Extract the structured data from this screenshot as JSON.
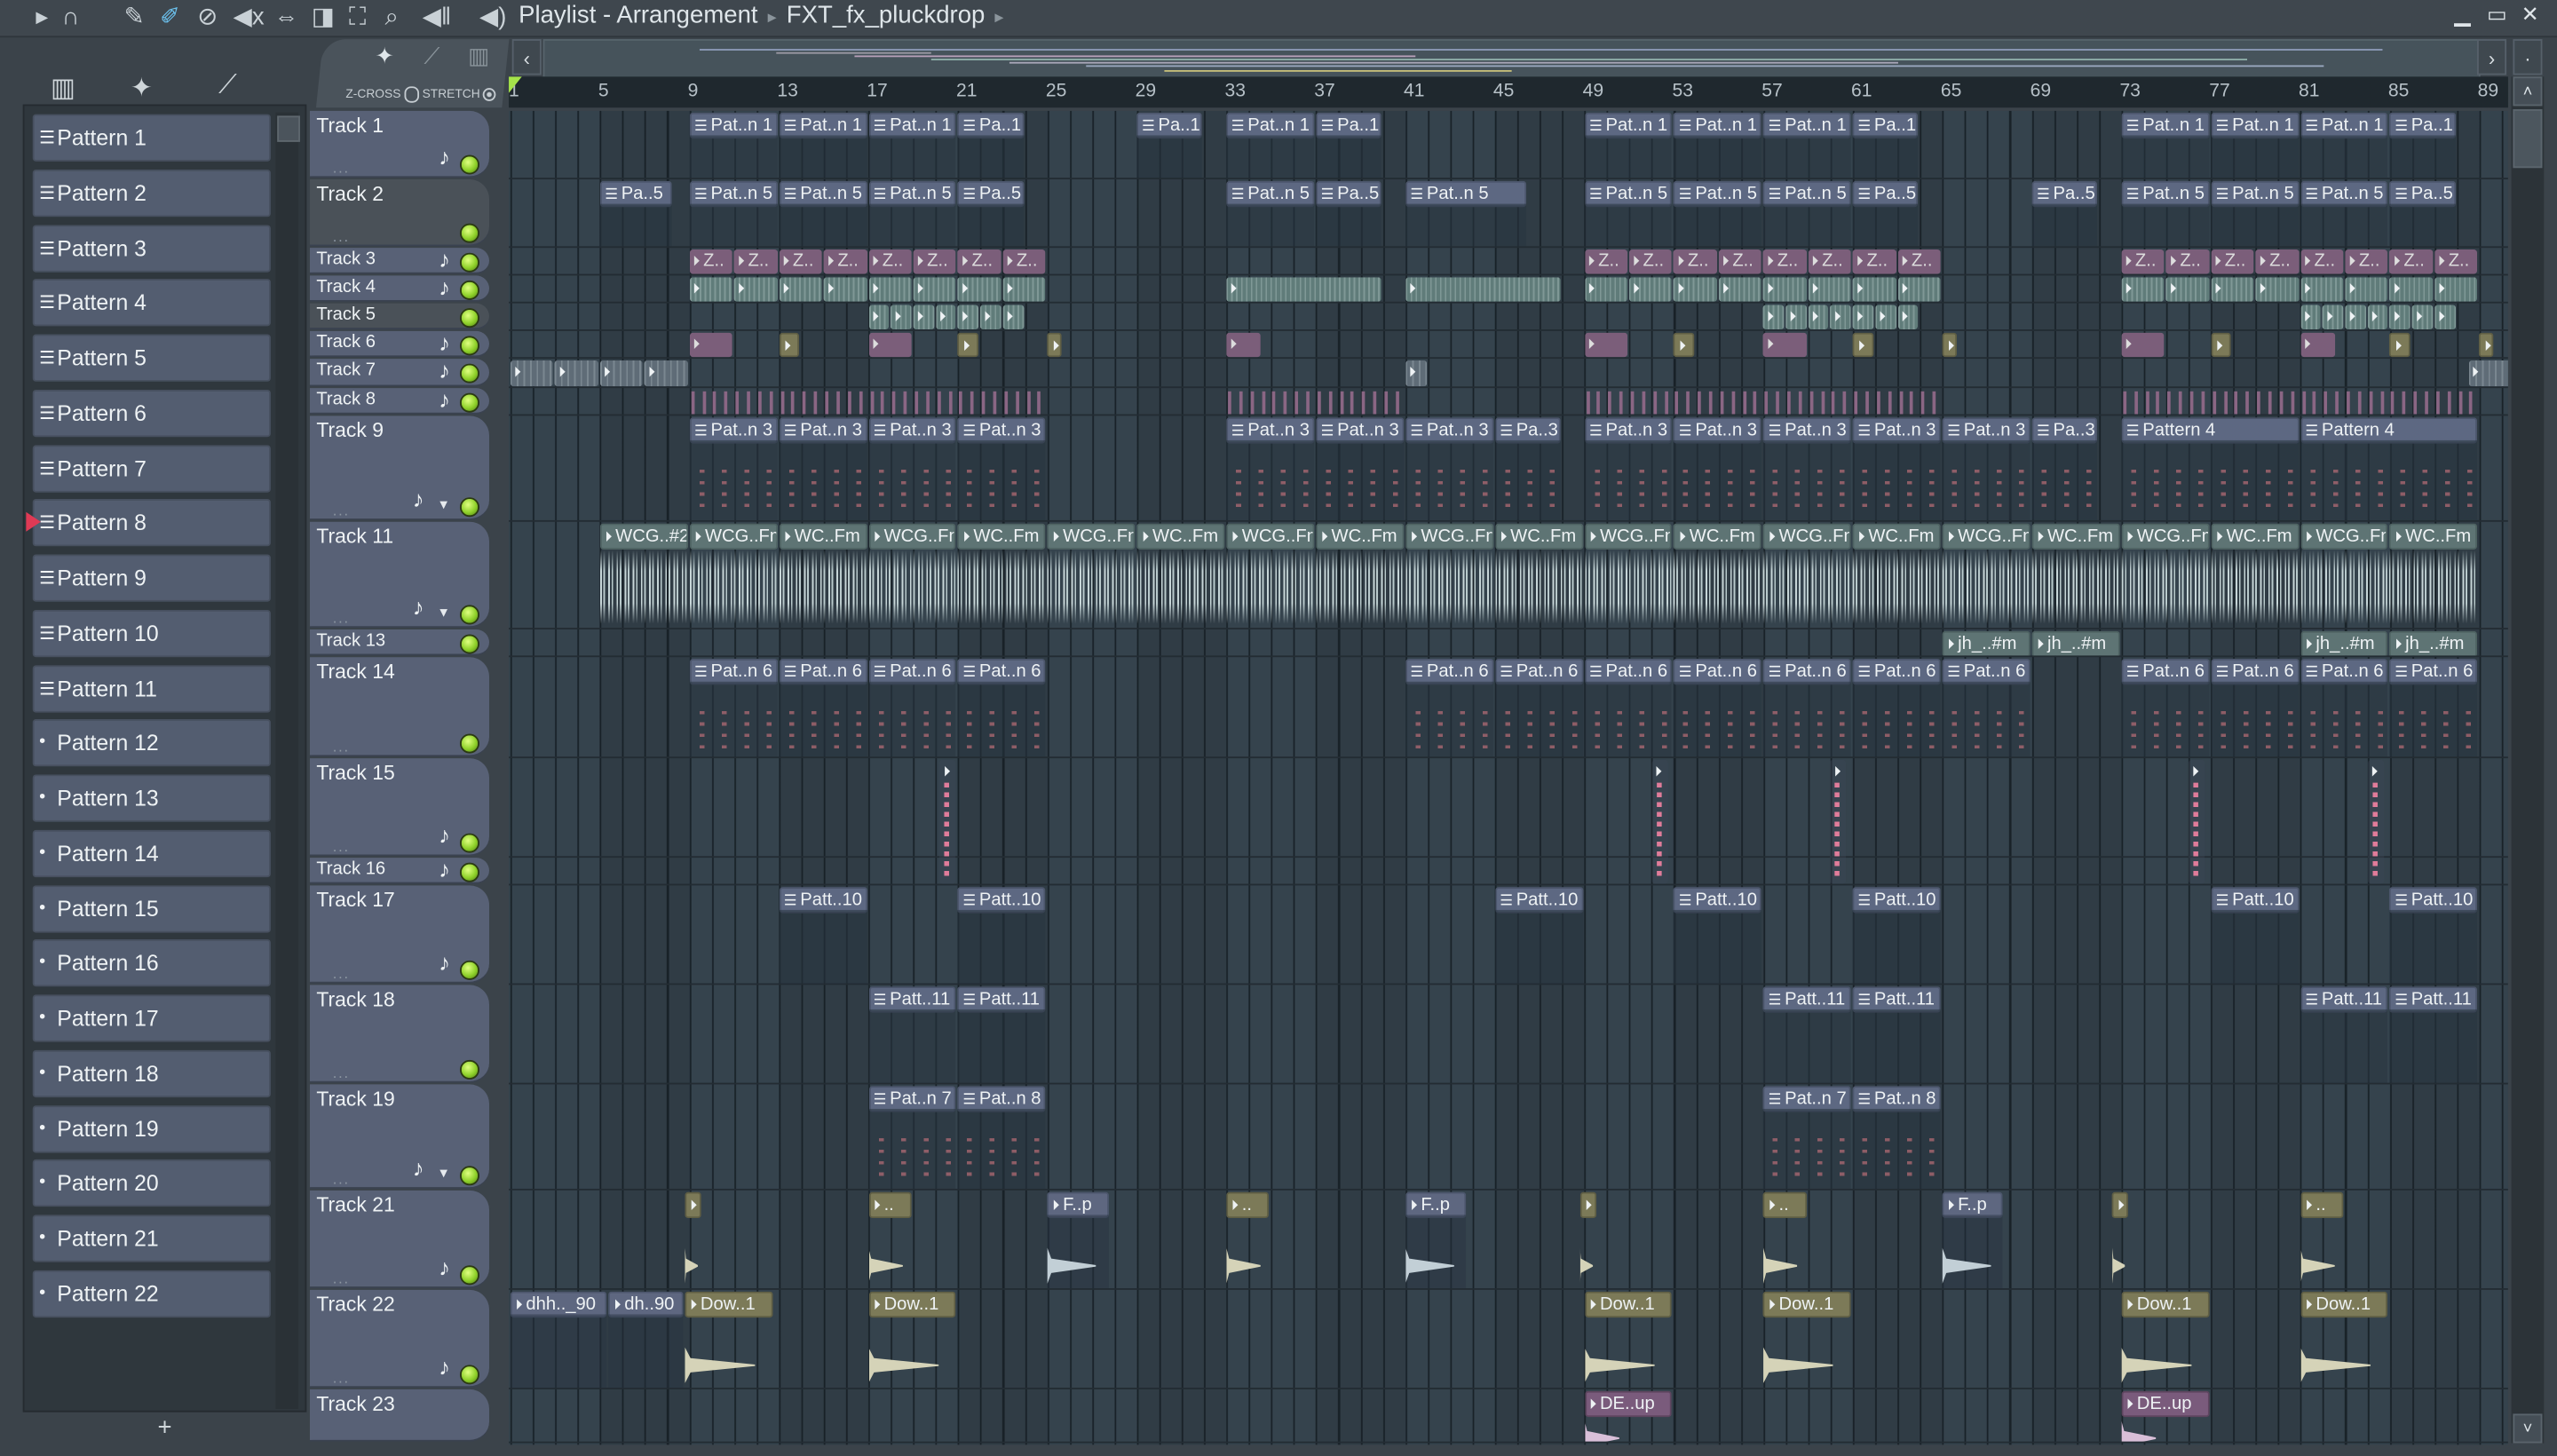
{
  "titlebar": {
    "title": "Playlist - Arrangement",
    "breadcrumb_sep": "▸",
    "current": "FXT_fx_pluckdrop",
    "toolbar_icons": [
      "play-arrow-icon",
      "magnet-snap-icon",
      "pencil-draw-icon",
      "paint-brush-icon",
      "delete-icon",
      "mute-icon",
      "slip-icon",
      "slice-icon",
      "select-icon",
      "zoom-icon",
      "playback-icon",
      "speaker-icon"
    ],
    "window_controls": {
      "minimize": "▁",
      "maximize": "▭",
      "close": "✕"
    }
  },
  "left_panel": {
    "view_icons": [
      "piano-roll-view-icon",
      "audio-view-icon",
      "automation-view-icon"
    ],
    "patterns": [
      {
        "label": "Pattern 1",
        "kind": "pattern"
      },
      {
        "label": "Pattern 2",
        "kind": "pattern"
      },
      {
        "label": "Pattern 3",
        "kind": "pattern"
      },
      {
        "label": "Pattern 4",
        "kind": "pattern"
      },
      {
        "label": "Pattern 5",
        "kind": "pattern"
      },
      {
        "label": "Pattern 6",
        "kind": "pattern"
      },
      {
        "label": "Pattern 7",
        "kind": "pattern"
      },
      {
        "label": "Pattern 8",
        "kind": "pattern",
        "selected": true
      },
      {
        "label": "Pattern 9",
        "kind": "pattern"
      },
      {
        "label": "Pattern 10",
        "kind": "pattern"
      },
      {
        "label": "Pattern 11",
        "kind": "pattern"
      },
      {
        "label": "Pattern 12",
        "kind": "empty"
      },
      {
        "label": "Pattern 13",
        "kind": "empty"
      },
      {
        "label": "Pattern 14",
        "kind": "empty"
      },
      {
        "label": "Pattern 15",
        "kind": "empty"
      },
      {
        "label": "Pattern 16",
        "kind": "empty"
      },
      {
        "label": "Pattern 17",
        "kind": "empty"
      },
      {
        "label": "Pattern 18",
        "kind": "empty"
      },
      {
        "label": "Pattern 19",
        "kind": "empty"
      },
      {
        "label": "Pattern 20",
        "kind": "empty"
      },
      {
        "label": "Pattern 21",
        "kind": "empty"
      },
      {
        "label": "Pattern 22",
        "kind": "empty"
      }
    ],
    "add_label": "+"
  },
  "header_tools": {
    "zcross_label": "Z-CROSS",
    "stretch_label": "STRETCH"
  },
  "ruler": {
    "bars": [
      1,
      5,
      9,
      13,
      17,
      21,
      25,
      29,
      33,
      37,
      41,
      45,
      49,
      53,
      57,
      61,
      65,
      69,
      73,
      77,
      81,
      85,
      89
    ]
  },
  "tracks": [
    {
      "name": "Track 1",
      "note": true
    },
    {
      "name": "Track 2",
      "note": false,
      "dark": true
    },
    {
      "name": "Track 3",
      "note": true
    },
    {
      "name": "Track 4",
      "note": true
    },
    {
      "name": "Track 5",
      "note": false,
      "dark": true
    },
    {
      "name": "Track 6",
      "note": true
    },
    {
      "name": "Track 7",
      "note": true
    },
    {
      "name": "Track 8",
      "note": true
    },
    {
      "name": "Track 9",
      "note": true,
      "dropdown": true
    },
    {
      "name": "Track 11",
      "note": true,
      "dropdown": true
    },
    {
      "name": "Track 13",
      "note": false
    },
    {
      "name": "Track 14",
      "note": false
    },
    {
      "name": "Track 15",
      "note": true
    },
    {
      "name": "Track 16",
      "note": true
    },
    {
      "name": "Track 17",
      "note": true
    },
    {
      "name": "Track 18",
      "note": false
    },
    {
      "name": "Track 19",
      "note": true,
      "dropdown": true
    },
    {
      "name": "Track 21",
      "note": true
    },
    {
      "name": "Track 22",
      "note": true
    },
    {
      "name": "Track 23",
      "note": false
    }
  ],
  "clips": [
    {
      "t": 0,
      "s": 9,
      "l": 4,
      "n": 3,
      "label": "Pat..n 1",
      "style": "pat"
    },
    {
      "t": 0,
      "s": 21,
      "l": 3,
      "n": 1,
      "label": "Pa..1",
      "style": "pat"
    },
    {
      "t": 0,
      "s": 29,
      "l": 3,
      "n": 1,
      "label": "Pa..1",
      "style": "pat"
    },
    {
      "t": 0,
      "s": 33,
      "l": 4,
      "n": 1,
      "label": "Pat..n 1",
      "style": "pat"
    },
    {
      "t": 0,
      "s": 37,
      "l": 3,
      "n": 1,
      "label": "Pa..1",
      "style": "pat"
    },
    {
      "t": 0,
      "s": 49,
      "l": 4,
      "n": 3,
      "label": "Pat..n 1",
      "style": "pat"
    },
    {
      "t": 0,
      "s": 61,
      "l": 3,
      "n": 1,
      "label": "Pa..1",
      "style": "pat"
    },
    {
      "t": 0,
      "s": 73,
      "l": 4,
      "n": 3,
      "label": "Pat..n 1",
      "style": "pat"
    },
    {
      "t": 0,
      "s": 85,
      "l": 3,
      "n": 1,
      "label": "Pa..1",
      "style": "pat"
    },
    {
      "t": 1,
      "s": 5,
      "l": 3.3,
      "n": 1,
      "label": "Pa..5",
      "style": "pat"
    },
    {
      "t": 1,
      "s": 9,
      "l": 4,
      "n": 3,
      "label": "Pat..n 5",
      "style": "pat"
    },
    {
      "t": 1,
      "s": 21,
      "l": 3,
      "n": 1,
      "label": "Pa..5",
      "style": "pat"
    },
    {
      "t": 1,
      "s": 33,
      "l": 4,
      "n": 1,
      "label": "Pat..n 5",
      "style": "pat"
    },
    {
      "t": 1,
      "s": 37,
      "l": 3,
      "n": 1,
      "label": "Pa..5",
      "style": "pat"
    },
    {
      "t": 1,
      "s": 41,
      "l": 5.5,
      "n": 1,
      "label": "Pat..n 5",
      "style": "pat"
    },
    {
      "t": 1,
      "s": 49,
      "l": 4,
      "n": 3,
      "label": "Pat..n 5",
      "style": "pat"
    },
    {
      "t": 1,
      "s": 61,
      "l": 3,
      "n": 1,
      "label": "Pa..5",
      "style": "pat"
    },
    {
      "t": 1,
      "s": 69,
      "l": 3,
      "n": 1,
      "label": "Pa..5",
      "style": "pat"
    },
    {
      "t": 1,
      "s": 73,
      "l": 4,
      "n": 3,
      "label": "Pat..n 5",
      "style": "pat"
    },
    {
      "t": 1,
      "s": 85,
      "l": 3,
      "n": 1,
      "label": "Pa..5",
      "style": "pat"
    },
    {
      "t": 2,
      "s": 9,
      "l": 2,
      "n": 8,
      "label": "Z..",
      "style": "purple"
    },
    {
      "t": 2,
      "s": 49,
      "l": 2,
      "n": 8,
      "label": "Z..",
      "style": "purple"
    },
    {
      "t": 2,
      "s": 73,
      "l": 2,
      "n": 8,
      "label": "Z..",
      "style": "purple"
    },
    {
      "t": 3,
      "s": 9,
      "l": 2,
      "n": 8,
      "label": "",
      "style": "teal"
    },
    {
      "t": 3,
      "s": 33,
      "l": 7,
      "n": 1,
      "label": "",
      "style": "teal"
    },
    {
      "t": 3,
      "s": 41,
      "l": 7,
      "n": 1,
      "label": "",
      "style": "teal"
    },
    {
      "t": 3,
      "s": 49,
      "l": 2,
      "n": 8,
      "label": "",
      "style": "teal"
    },
    {
      "t": 3,
      "s": 73,
      "l": 2,
      "n": 8,
      "label": "",
      "style": "teal"
    },
    {
      "t": 4,
      "s": 17,
      "l": 1,
      "n": 7,
      "label": "",
      "style": "teal"
    },
    {
      "t": 4,
      "s": 57,
      "l": 1,
      "n": 7,
      "label": "",
      "style": "teal"
    },
    {
      "t": 4,
      "s": 81,
      "l": 1,
      "n": 7,
      "label": "",
      "style": "teal"
    },
    {
      "t": 5,
      "s": 9,
      "l": 2,
      "n": 1,
      "label": "",
      "style": "purple"
    },
    {
      "t": 5,
      "s": 13,
      "l": 1,
      "n": 1,
      "label": "",
      "style": "olive solo"
    },
    {
      "t": 5,
      "s": 17,
      "l": 2,
      "n": 1,
      "label": "",
      "style": "purple"
    },
    {
      "t": 5,
      "s": 21,
      "l": 1,
      "n": 1,
      "label": "",
      "style": "olive solo"
    },
    {
      "t": 5,
      "s": 25,
      "l": 0.7,
      "n": 1,
      "label": "",
      "style": "olive solo"
    },
    {
      "t": 5,
      "s": 33,
      "l": 1.6,
      "n": 1,
      "label": "",
      "style": "purple"
    },
    {
      "t": 5,
      "s": 49,
      "l": 2,
      "n": 1,
      "label": "",
      "style": "purple"
    },
    {
      "t": 5,
      "s": 53,
      "l": 1,
      "n": 1,
      "label": "",
      "style": "olive solo"
    },
    {
      "t": 5,
      "s": 57,
      "l": 2,
      "n": 1,
      "label": "",
      "style": "purple"
    },
    {
      "t": 5,
      "s": 61,
      "l": 1,
      "n": 1,
      "label": "",
      "style": "olive solo"
    },
    {
      "t": 5,
      "s": 65,
      "l": 0.7,
      "n": 1,
      "label": "",
      "style": "olive solo"
    },
    {
      "t": 5,
      "s": 73,
      "l": 2,
      "n": 1,
      "label": "",
      "style": "purple"
    },
    {
      "t": 5,
      "s": 77,
      "l": 1,
      "n": 1,
      "label": "",
      "style": "olive solo"
    },
    {
      "t": 5,
      "s": 81,
      "l": 1.6,
      "n": 1,
      "label": "",
      "style": "purple"
    },
    {
      "t": 5,
      "s": 85,
      "l": 1,
      "n": 1,
      "label": "",
      "style": "olive solo"
    },
    {
      "t": 5,
      "s": 89,
      "l": 0.7,
      "n": 1,
      "label": "",
      "style": "olive solo"
    },
    {
      "t": 6,
      "s": 1,
      "l": 2,
      "n": 4,
      "label": "",
      "style": "gray"
    },
    {
      "t": 6,
      "s": 41,
      "l": 1,
      "n": 1,
      "label": "",
      "style": "gray"
    },
    {
      "t": 6,
      "s": 88.5,
      "l": 2,
      "n": 1,
      "label": "",
      "style": "gray"
    },
    {
      "t": 7,
      "s": 9,
      "l": 16,
      "n": 1,
      "label": "",
      "style": "tick"
    },
    {
      "t": 7,
      "s": 33,
      "l": 8,
      "n": 1,
      "label": "",
      "style": "tick"
    },
    {
      "t": 7,
      "s": 49,
      "l": 16,
      "n": 1,
      "label": "",
      "style": "tick"
    },
    {
      "t": 7,
      "s": 73,
      "l": 16,
      "n": 1,
      "label": "",
      "style": "tick"
    },
    {
      "t": 8,
      "s": 9,
      "l": 4,
      "n": 4,
      "label": "Pat..n 3",
      "style": "pat notes"
    },
    {
      "t": 8,
      "s": 33,
      "l": 4,
      "n": 3,
      "label": "Pat..n 3",
      "style": "pat notes"
    },
    {
      "t": 8,
      "s": 45,
      "l": 3,
      "n": 1,
      "label": "Pa..3",
      "style": "pat notes"
    },
    {
      "t": 8,
      "s": 49,
      "l": 4,
      "n": 5,
      "label": "Pat..n 3",
      "style": "pat notes"
    },
    {
      "t": 8,
      "s": 69,
      "l": 3,
      "n": 1,
      "label": "Pa..3",
      "style": "pat notes"
    },
    {
      "t": 8,
      "s": 73,
      "l": 8,
      "n": 2,
      "label": "Pattern 4",
      "style": "pat notes"
    },
    {
      "t": 9,
      "s": 5,
      "l": 4,
      "n": 1,
      "label": "WCG..#2",
      "style": "sage wave"
    },
    {
      "t": 9,
      "s": 9,
      "l": 4,
      "n": 10,
      "step": 8,
      "label": "WCG..Fm",
      "style": "sage wave"
    },
    {
      "t": 9,
      "s": 13,
      "l": 4,
      "n": 10,
      "step": 8,
      "label": "WC..Fm",
      "style": "sage wave"
    },
    {
      "t": 10,
      "s": 65,
      "l": 4,
      "n": 2,
      "label": "jh_..#m",
      "style": "sage"
    },
    {
      "t": 10,
      "s": 81,
      "l": 4,
      "n": 2,
      "label": "jh_..#m",
      "style": "sage"
    },
    {
      "t": 11,
      "s": 9,
      "l": 4,
      "n": 4,
      "label": "Pat..n 6",
      "style": "pat notes"
    },
    {
      "t": 11,
      "s": 41,
      "l": 4,
      "n": 7,
      "label": "Pat..n 6",
      "style": "pat notes"
    },
    {
      "t": 11,
      "s": 73,
      "l": 4,
      "n": 4,
      "label": "Pat..n 6",
      "style": "pat notes"
    },
    {
      "t": 12,
      "s": 20.2,
      "l": 0.8,
      "n": 1,
      "label": "",
      "style": "thin"
    },
    {
      "t": 12,
      "s": 52,
      "l": 0.8,
      "n": 1,
      "label": "",
      "style": "thin"
    },
    {
      "t": 12,
      "s": 60,
      "l": 0.8,
      "n": 1,
      "label": "",
      "style": "thin"
    },
    {
      "t": 12,
      "s": 76,
      "l": 0.8,
      "n": 1,
      "label": "",
      "style": "thin"
    },
    {
      "t": 12,
      "s": 84,
      "l": 0.8,
      "n": 1,
      "label": "",
      "style": "thin"
    },
    {
      "t": 14,
      "s": 13,
      "l": 4,
      "n": 1,
      "label": "Patt..10",
      "style": "pat"
    },
    {
      "t": 14,
      "s": 21,
      "l": 4,
      "n": 1,
      "label": "Patt..10",
      "style": "pat"
    },
    {
      "t": 14,
      "s": 45,
      "l": 4,
      "n": 1,
      "label": "Patt..10",
      "style": "pat"
    },
    {
      "t": 14,
      "s": 53,
      "l": 4,
      "n": 1,
      "label": "Patt..10",
      "style": "pat"
    },
    {
      "t": 14,
      "s": 61,
      "l": 4,
      "n": 1,
      "label": "Patt..10",
      "style": "pat"
    },
    {
      "t": 14,
      "s": 77,
      "l": 4,
      "n": 1,
      "label": "Patt..10",
      "style": "pat"
    },
    {
      "t": 14,
      "s": 85,
      "l": 4,
      "n": 1,
      "label": "Patt..10",
      "style": "pat"
    },
    {
      "t": 15,
      "s": 17,
      "l": 4,
      "n": 2,
      "label": "Patt..11",
      "style": "pat"
    },
    {
      "t": 15,
      "s": 57,
      "l": 4,
      "n": 2,
      "label": "Patt..11",
      "style": "pat"
    },
    {
      "t": 15,
      "s": 81,
      "l": 4,
      "n": 2,
      "label": "Patt..11",
      "style": "pat"
    },
    {
      "t": 16,
      "s": 17,
      "l": 4,
      "n": 1,
      "label": "Pat..n 7",
      "style": "pat notes"
    },
    {
      "t": 16,
      "s": 21,
      "l": 4,
      "n": 1,
      "label": "Pat..n 8",
      "style": "pat notes"
    },
    {
      "t": 16,
      "s": 57,
      "l": 4,
      "n": 1,
      "label": "Pat..n 7",
      "style": "pat notes"
    },
    {
      "t": 16,
      "s": 61,
      "l": 4,
      "n": 1,
      "label": "Pat..n 8",
      "style": "pat notes"
    },
    {
      "t": 17,
      "s": 8.8,
      "l": 0.8,
      "n": 1,
      "label": "",
      "style": "olive decayc"
    },
    {
      "t": 17,
      "s": 17,
      "l": 2,
      "n": 1,
      "label": "..",
      "style": "olive decayc"
    },
    {
      "t": 17,
      "s": 25,
      "l": 2.8,
      "n": 1,
      "label": "F..p",
      "style": "slate decayc"
    },
    {
      "t": 17,
      "s": 33,
      "l": 2,
      "n": 1,
      "label": "..",
      "style": "olive decayc"
    },
    {
      "t": 17,
      "s": 41,
      "l": 2.8,
      "n": 1,
      "label": "F..p",
      "style": "slate decayc"
    },
    {
      "t": 17,
      "s": 48.8,
      "l": 0.8,
      "n": 1,
      "label": "",
      "style": "olive decayc"
    },
    {
      "t": 17,
      "s": 57,
      "l": 2,
      "n": 1,
      "label": "..",
      "style": "olive decayc"
    },
    {
      "t": 17,
      "s": 65,
      "l": 2.8,
      "n": 1,
      "label": "F..p",
      "style": "slate decayc"
    },
    {
      "t": 17,
      "s": 72.6,
      "l": 0.8,
      "n": 1,
      "label": "",
      "style": "olive decayc"
    },
    {
      "t": 17,
      "s": 81,
      "l": 2,
      "n": 1,
      "label": "..",
      "style": "olive decayc"
    },
    {
      "t": 18,
      "s": 1,
      "l": 4.4,
      "n": 1,
      "label": "dhh.._90",
      "style": "slate"
    },
    {
      "t": 18,
      "s": 5.4,
      "l": 3.4,
      "n": 1,
      "label": "dh..90",
      "style": "slate"
    },
    {
      "t": 18,
      "s": 8.8,
      "l": 4,
      "n": 1,
      "label": "Dow..1",
      "style": "olive decayc"
    },
    {
      "t": 18,
      "s": 17,
      "l": 4,
      "n": 1,
      "label": "Dow..1",
      "style": "olive decayc"
    },
    {
      "t": 18,
      "s": 49,
      "l": 4,
      "n": 1,
      "label": "Dow..1",
      "style": "olive decayc"
    },
    {
      "t": 18,
      "s": 57,
      "l": 4,
      "n": 1,
      "label": "Dow..1",
      "style": "olive decayc"
    },
    {
      "t": 18,
      "s": 73,
      "l": 4,
      "n": 1,
      "label": "Dow..1",
      "style": "olive decayc"
    },
    {
      "t": 18,
      "s": 81,
      "l": 4,
      "n": 1,
      "label": "Dow..1",
      "style": "olive decayc"
    },
    {
      "t": 19,
      "s": 49,
      "l": 4,
      "n": 1,
      "label": "DE..up",
      "style": "dpurple"
    },
    {
      "t": 19,
      "s": 73,
      "l": 4,
      "n": 1,
      "label": "DE..up",
      "style": "dpurple"
    }
  ],
  "colors": {
    "accent_green": "#8fd12a",
    "selected_marker": "#e03a55",
    "clip_pattern": "#5d6882",
    "clip_purple": "#7b5e7a",
    "clip_olive": "#7c7a58",
    "clip_sage": "#5e7474"
  }
}
